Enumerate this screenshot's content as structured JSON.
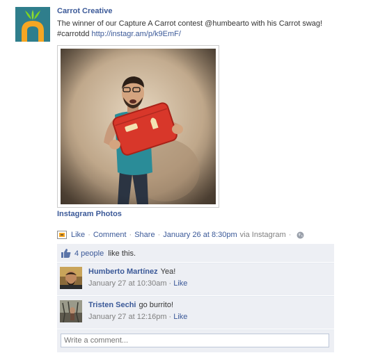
{
  "post": {
    "author": "Carrot Creative",
    "message": "The winner of our Capture A Carrot contest @humbearto with his Carrot swag! #carrotdd",
    "link": "http://instagr.am/p/k9EmF/",
    "album": "Instagram Photos"
  },
  "actions": {
    "like": "Like",
    "comment": "Comment",
    "share": "Share",
    "timestamp": "January 26 at 8:30pm",
    "via": "via Instagram"
  },
  "likes": {
    "count_label": "4 people",
    "suffix": "like this."
  },
  "comments": [
    {
      "author": "Humberto Martínez",
      "text": "Yea!",
      "time": "January 27 at 10:30am",
      "like": "Like"
    },
    {
      "author": "Tristen Sechi",
      "text": "go burrito!",
      "time": "January 27 at 12:16pm",
      "like": "Like"
    }
  ],
  "composer": {
    "placeholder": "Write a comment..."
  },
  "colors": {
    "link": "#3b5998",
    "ufi_bg": "#edeff4",
    "carrot_logo_bg": "#2f7e8c"
  },
  "icons": [
    "carrot-logo",
    "share-icon",
    "globe-icon",
    "thumbs-up-icon"
  ]
}
